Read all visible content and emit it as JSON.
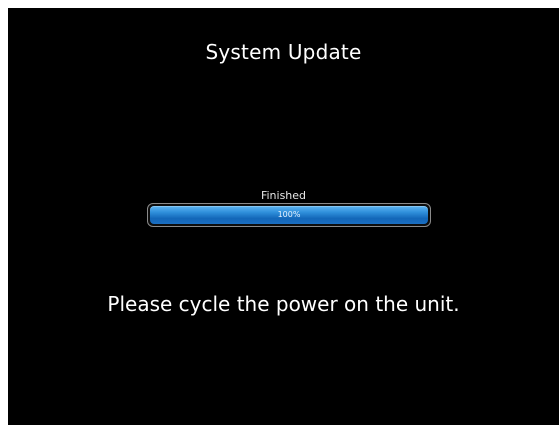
{
  "screen": {
    "title": "System Update",
    "status_label": "Finished",
    "progress": {
      "percent": 100,
      "label": "100%"
    },
    "message": "Please cycle the power on the unit."
  },
  "colors": {
    "background": "#000000",
    "text": "#ffffff",
    "progress_fill": "#1e7fd1"
  }
}
